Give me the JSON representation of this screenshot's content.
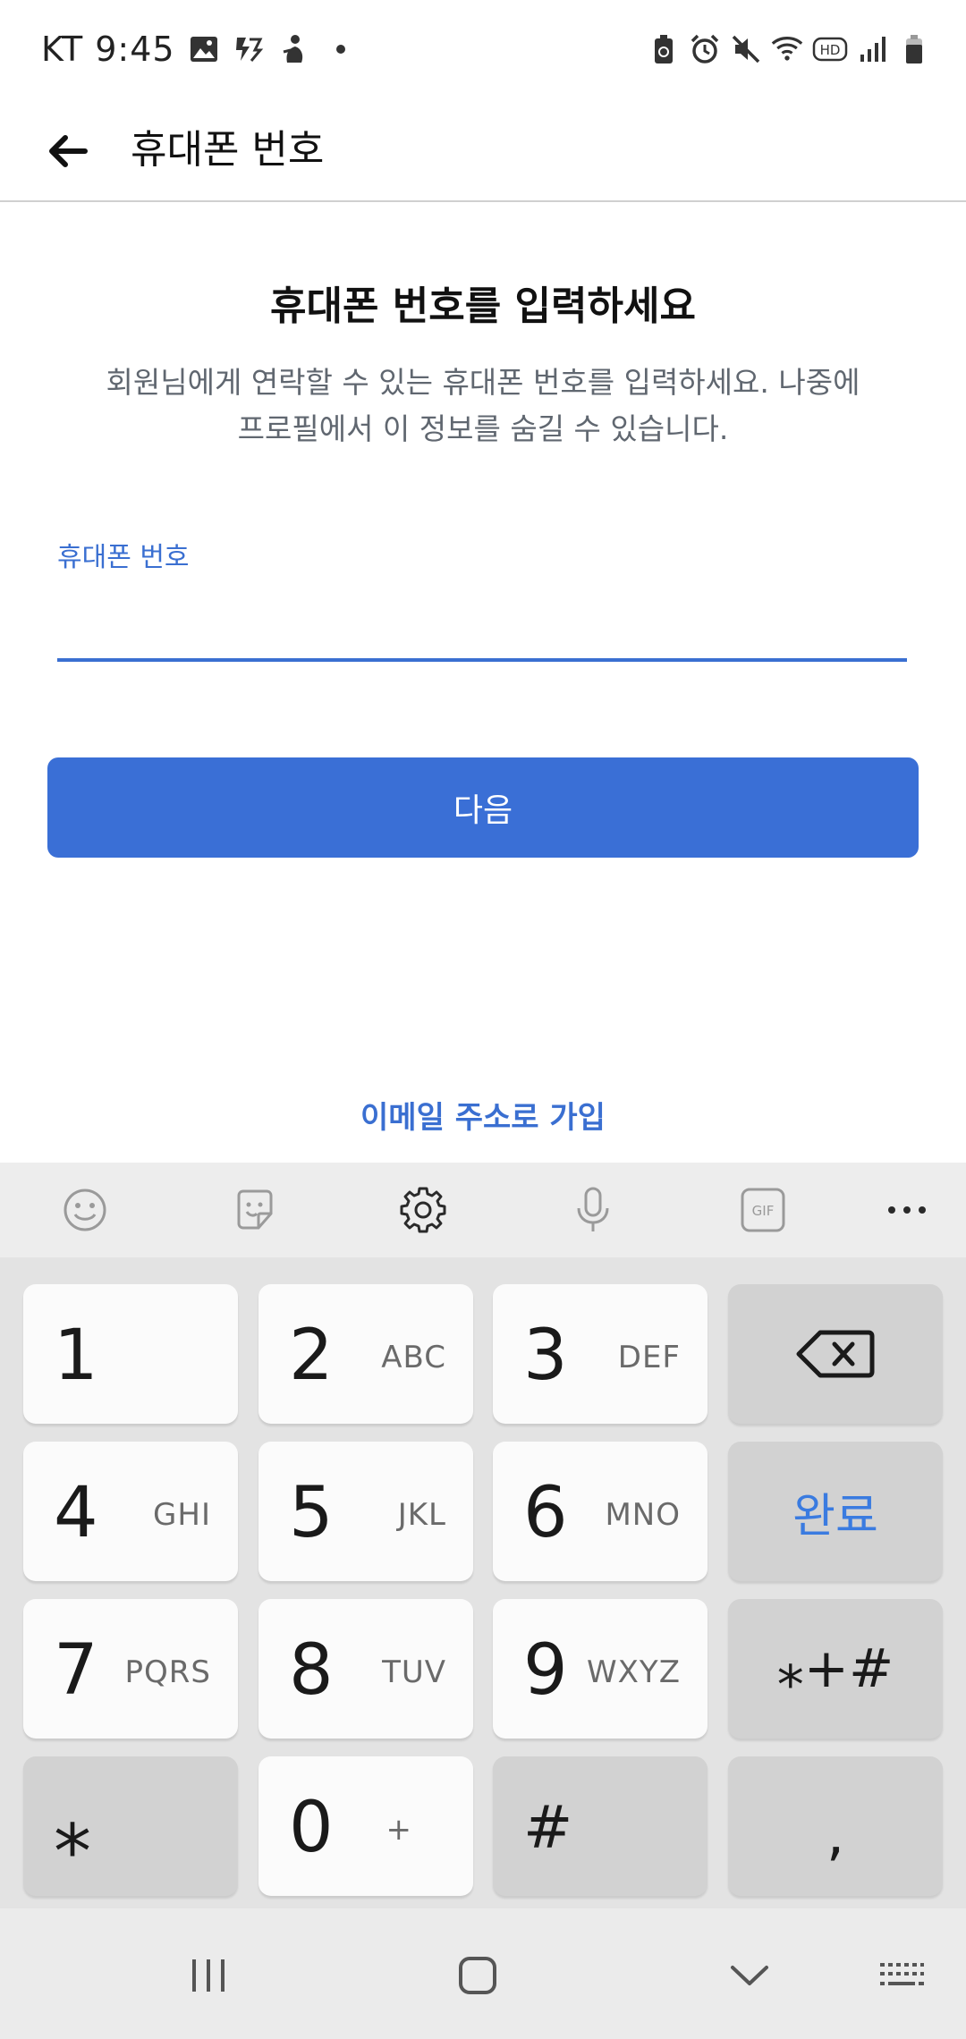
{
  "status_bar": {
    "carrier_time": "KT 9:45",
    "icons_left": [
      "gallery-icon",
      "flash-icon",
      "figure-icon",
      "dot"
    ],
    "icons_right": [
      "battery-saver-icon",
      "alarm-icon",
      "mute-icon",
      "wifi-icon",
      "hd-icon",
      "signal-icon",
      "battery-icon"
    ],
    "hd_label": "HD"
  },
  "app_bar": {
    "title": "휴대폰 번호"
  },
  "content": {
    "heading": "휴대폰 번호를 입력하세요",
    "description_line1": "회원님에게 연락할 수 있는 휴대폰 번호를 입력하세요. 나중에",
    "description_line2": "프로필에서 이 정보를 숨길 수 있습니다.",
    "field_label": "휴대폰 번호",
    "field_value": "",
    "next_button": "다음",
    "email_link": "이메일 주소로 가입"
  },
  "keyboard": {
    "toolbar": [
      "emoji-icon",
      "sticker-icon",
      "settings-icon",
      "microphone-icon",
      "gif-icon",
      "more-icon"
    ],
    "gif_label": "GIF",
    "keys": {
      "k1": {
        "num": "1",
        "sub": ""
      },
      "k2": {
        "num": "2",
        "sub": "ABC"
      },
      "k3": {
        "num": "3",
        "sub": "DEF"
      },
      "k4": {
        "num": "4",
        "sub": "GHI"
      },
      "k5": {
        "num": "5",
        "sub": "JKL"
      },
      "k6": {
        "num": "6",
        "sub": "MNO"
      },
      "k7": {
        "num": "7",
        "sub": "PQRS"
      },
      "k8": {
        "num": "8",
        "sub": "TUV"
      },
      "k9": {
        "num": "9",
        "sub": "WXYZ"
      },
      "k0": {
        "num": "0",
        "sub": "+"
      },
      "star": "⁎",
      "hash": "#",
      "comma": ",",
      "done": "완료",
      "symbols": "⁎+#"
    }
  },
  "colors": {
    "accent": "#3a6fd6",
    "label_blue": "#3a6fd1",
    "done_blue": "#3a7be0",
    "text_gray": "#606770"
  }
}
